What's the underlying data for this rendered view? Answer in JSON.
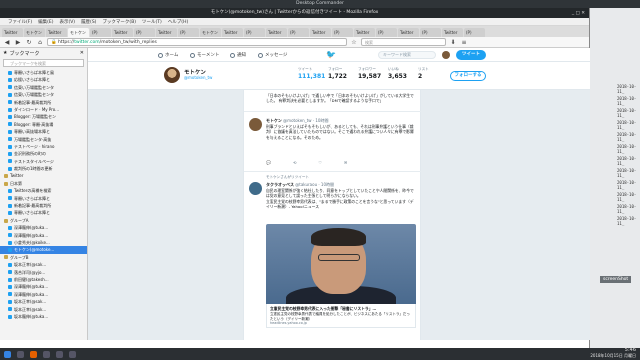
{
  "os": {
    "titlebar": "Desktop Commander"
  },
  "window": {
    "title": "モトケン(@motoken_tw)さん | Twitterからの返信付きツイート - Mozilla Firefox",
    "controls": "_ □ ✕"
  },
  "menubar": [
    "ファイル(F)",
    "編集(E)",
    "表示(V)",
    "履歴(S)",
    "ブックマーク(B)",
    "ツール(T)",
    "ヘルプ(H)"
  ],
  "tabs": [
    {
      "label": "Twitter",
      "active": false
    },
    {
      "label": "モトケン",
      "active": false
    },
    {
      "label": "Twitter",
      "active": false
    },
    {
      "label": "モトケン",
      "active": true
    },
    {
      "label": "(P)",
      "active": false
    },
    {
      "label": "Twitter",
      "active": false
    },
    {
      "label": "(P)",
      "active": false
    },
    {
      "label": "Twitter",
      "active": false
    },
    {
      "label": "(P)",
      "active": false
    },
    {
      "label": "モトケン",
      "active": false
    },
    {
      "label": "Twitter",
      "active": false
    },
    {
      "label": "(P)",
      "active": false
    },
    {
      "label": "Twitter",
      "active": false
    },
    {
      "label": "(P)",
      "active": false
    },
    {
      "label": "Twitter",
      "active": false
    },
    {
      "label": "(P)",
      "active": false
    },
    {
      "label": "Twitter",
      "active": false
    },
    {
      "label": "(P)",
      "active": false
    },
    {
      "label": "Twitter",
      "active": false
    },
    {
      "label": "(P)",
      "active": false
    },
    {
      "label": "Twitter",
      "active": false
    },
    {
      "label": "(P)",
      "active": false
    }
  ],
  "navbar": {
    "url_prefix": "https://",
    "url_host": "twitter.com",
    "url_path": "/motoken_tw/with_replies",
    "search_placeholder": "検索"
  },
  "sidebar": {
    "title": "ブックマーク",
    "search_placeholder": "ブックマークを検索",
    "items": [
      {
        "label": "専願いさらば本陣と風",
        "folder": false,
        "selected": false
      },
      {
        "label": "応援いさらば本陣と",
        "folder": false,
        "selected": false
      },
      {
        "label": "信東い万場鑑監センタ",
        "folder": false,
        "selected": false
      },
      {
        "label": "信東い万場鑑監センタ",
        "folder": false,
        "selected": false
      },
      {
        "label": "新着記事·最高裁判所",
        "folder": false,
        "selected": false
      },
      {
        "label": "ダインロード · My Pro...",
        "folder": false,
        "selected": false
      },
      {
        "label": "Blogger: 万場鑑監セン",
        "folder": false,
        "selected": false
      },
      {
        "label": "Blogger: 専願·高抜場",
        "folder": false,
        "selected": false
      },
      {
        "label": "専願い高抜場本陣と",
        "folder": false,
        "selected": false
      },
      {
        "label": "万場鑑監センタ·高抜",
        "folder": false,
        "selected": false
      },
      {
        "label": "テストページ · hirano",
        "folder": false,
        "selected": false
      },
      {
        "label": "金沢刑務所の町の",
        "folder": false,
        "selected": false
      },
      {
        "label": "テストスタイルページ",
        "folder": false,
        "selected": false
      },
      {
        "label": "裁判所の1時間の更新",
        "folder": false,
        "selected": false
      },
      {
        "label": "Twitter",
        "folder": true,
        "selected": false
      },
      {
        "label": "日本第",
        "folder": true,
        "selected": false
      },
      {
        "label": "Twitterの高橋を検索",
        "folder": false,
        "selected": false
      },
      {
        "label": "専願いさらば本陣と",
        "folder": false,
        "selected": false
      },
      {
        "label": "新着記事·最高裁判所",
        "folder": false,
        "selected": false
      },
      {
        "label": "専願いさらば本陣と",
        "folder": false,
        "selected": false
      },
      {
        "label": "グループA",
        "folder": true,
        "selected": false
      },
      {
        "label": "深澤龍伸(@tuka...",
        "folder": false,
        "selected": false
      },
      {
        "label": "深澤龍伸(@tuka...",
        "folder": false,
        "selected": false
      },
      {
        "label": "小倉秀夫(@koike...",
        "folder": false,
        "selected": false
      },
      {
        "label": "モトケン(@motoke...",
        "folder": false,
        "selected": true
      },
      {
        "label": "グループB",
        "folder": true,
        "selected": false
      },
      {
        "label": "坂本正幸(@sak...",
        "folder": false,
        "selected": false
      },
      {
        "label": "落合洋司(@yjo...",
        "folder": false,
        "selected": false
      },
      {
        "label": "前田健(@takesh...",
        "folder": false,
        "selected": false
      },
      {
        "label": "深澤龍伸(@tuka...",
        "folder": false,
        "selected": false
      },
      {
        "label": "深澤龍伸(@tuka...",
        "folder": false,
        "selected": false
      },
      {
        "label": "坂本正幸(@sak...",
        "folder": false,
        "selected": false
      },
      {
        "label": "坂本正幸(@sak...",
        "folder": false,
        "selected": false
      },
      {
        "label": "坂本龍伸(@tuka...",
        "folder": false,
        "selected": false
      }
    ]
  },
  "twitter_nav": {
    "home": "ホーム",
    "moments": "モーメント",
    "notifications": "通知",
    "messages": "メッセージ",
    "search_placeholder": "キーワード検索",
    "tweet_button": "ツイート"
  },
  "profile": {
    "name": "モトケン",
    "handle": "@motoken_tw",
    "stats": [
      {
        "label": "ツイート",
        "value": "111,381"
      },
      {
        "label": "フォロー",
        "value": "1,722"
      },
      {
        "label": "フォロワー",
        "value": "19,587"
      },
      {
        "label": "いいね",
        "value": "3,653"
      },
      {
        "label": "リスト",
        "value": "2"
      }
    ],
    "follow_button": "フォローする"
  },
  "tweets": [
    {
      "head": "",
      "handle": "",
      "body": "「日本のそもいけよいげ」で通しい中で「日本のそもいけよいげ」がしている大学生でした。\n有罪判決を必要としますか。「DMで確認するような手口で」",
      "actions": [
        "",
        "",
        "",
        ""
      ]
    },
    {
      "head": "モトケン",
      "handle": "@motoken_tw · 10時間",
      "body": "刑事ブランドといえばそもそもしいが、あるとしても、それは刑事弁護という仕事（裁判）に協議を真法していたものではない。そこで通われる弁護につい人々に有罪で影響を与えることになる。そのため。",
      "actions": [
        "",
        "",
        "",
        ""
      ]
    },
    {
      "context": "モトケンさんがリツイート",
      "head": "タクラオッペス",
      "handle": "@takuraou · 10時間",
      "body": "自民の理室関係が強く結社したり、同意をトップとしていたことや人間関係を、昨今では党の意見として誤った主張として明らかにならない。\n立憲民主党の枝野幸男代表は、\"まるで勝手に政策のことを言うな\"と思っています（デイリー新潮）- Yahoo!ニュース",
      "card_title": "立憲民主党の枝野幸男代表に入った衝撃「秘書にリストラ」…",
      "card_desc": "立憲民主党の枝野幸男代表で議員を処分したことが、ビジネスにあたる「リストラ」だったという（デイリー新潮）",
      "card_url": "headlines.yahoo.co.jp",
      "actions": [
        "",
        "",
        "",
        ""
      ]
    }
  ],
  "taskbar": {
    "time": "5:46",
    "date": "2018年10月15日 月曜日"
  },
  "desktop": {
    "terminal_lines": [
      "2018-10-11_",
      "2018-10-11_",
      "2018-10-11_",
      "2018-10-11_",
      "2018-10-11_",
      "2018-10-11_",
      "2018-10-11_",
      "2018-10-11_",
      "2018-10-11_",
      "2018-10-11_",
      "2018-10-11_",
      "2018-10-11_"
    ],
    "screenshot_label": "screenShot"
  }
}
